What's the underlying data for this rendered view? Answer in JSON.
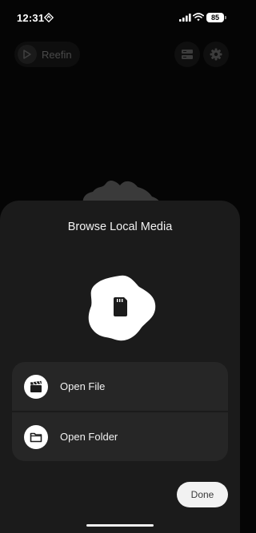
{
  "status_bar": {
    "time": "12:31",
    "battery": "85",
    "icons": [
      "location-arrow-icon",
      "signal-icon",
      "wifi-icon",
      "battery-icon"
    ]
  },
  "header": {
    "app_name": "Reefin",
    "icons": [
      "reefin-logo-icon",
      "server-icon",
      "gear-icon"
    ]
  },
  "sheet": {
    "title": "Browse Local Media",
    "hero_icon": "sd-card-icon",
    "options": [
      {
        "label": "Open File",
        "icon": "film-clapper-icon"
      },
      {
        "label": "Open Folder",
        "icon": "folder-icon"
      }
    ],
    "done_label": "Done"
  },
  "colors": {
    "background": "#050505",
    "sheet": "#1b1b1b",
    "card": "#262626",
    "accent_white": "#f2f2f2"
  }
}
